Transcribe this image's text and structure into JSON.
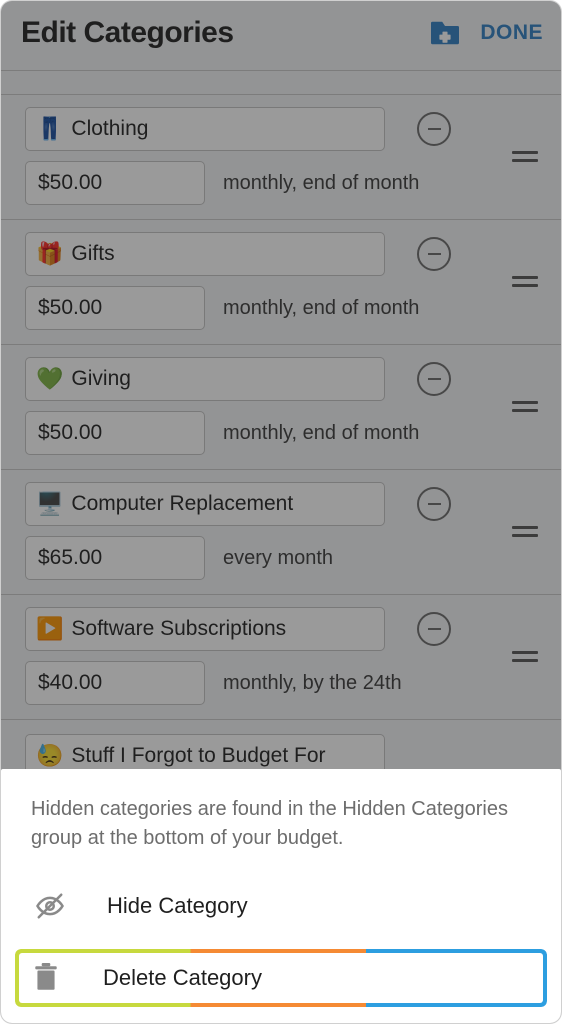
{
  "header": {
    "title": "Edit Categories",
    "done_label": "DONE"
  },
  "categories": [
    {
      "emoji": "👖",
      "name": "Clothing",
      "amount": "$50.00",
      "frequency": "monthly, end of month"
    },
    {
      "emoji": "🎁",
      "name": "Gifts",
      "amount": "$50.00",
      "frequency": "monthly, end of month"
    },
    {
      "emoji": "💚",
      "name": "Giving",
      "amount": "$50.00",
      "frequency": "monthly, end of month"
    },
    {
      "emoji": "🖥️",
      "name": "Computer Replacement",
      "amount": "$65.00",
      "frequency": "every month"
    },
    {
      "emoji": "▶️",
      "name": "Software Subscriptions",
      "amount": "$40.00",
      "frequency": "monthly, by the 24th"
    }
  ],
  "peek": {
    "emoji": "😓",
    "name": "Stuff I Forgot to Budget For"
  },
  "sheet": {
    "hint": "Hidden categories are found in the Hidden Categories group at the bottom of your budget.",
    "hide_label": "Hide Category",
    "delete_label": "Delete Category"
  }
}
